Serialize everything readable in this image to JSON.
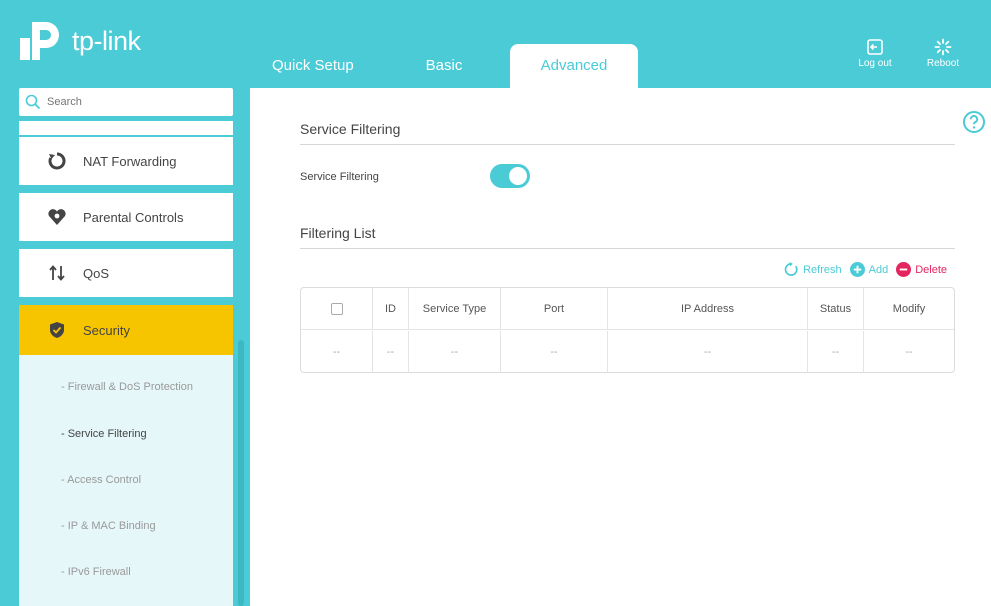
{
  "brand": {
    "name": "tp-link"
  },
  "colors": {
    "accent": "#4acbd6",
    "active_nav": "#f7c500",
    "add": "#4acbd6",
    "delete": "#e3265f"
  },
  "tabs": [
    {
      "label": "Quick Setup"
    },
    {
      "label": "Basic"
    },
    {
      "label": "Advanced"
    }
  ],
  "header_buttons": {
    "logout": "Log out",
    "reboot": "Reboot"
  },
  "search": {
    "placeholder": "Search"
  },
  "nav": {
    "items": [
      {
        "label": "NAT Forwarding",
        "icon": "nat-forwarding-icon"
      },
      {
        "label": "Parental Controls",
        "icon": "parental-controls-icon"
      },
      {
        "label": "QoS",
        "icon": "qos-icon"
      },
      {
        "label": "Security",
        "icon": "shield-icon"
      }
    ],
    "submenu": [
      {
        "label": "- Firewall & DoS Protection"
      },
      {
        "label": "- Service Filtering"
      },
      {
        "label": "- Access Control"
      },
      {
        "label": "- IP & MAC Binding"
      },
      {
        "label": "- IPv6 Firewall"
      }
    ]
  },
  "main": {
    "section_title": "Service Filtering",
    "toggle_label": "Service Filtering",
    "toggle_on": true,
    "list_title": "Filtering List",
    "actions": {
      "refresh": "Refresh",
      "add": "Add",
      "delete": "Delete"
    },
    "table": {
      "headers": [
        "",
        "ID",
        "Service Type",
        "Port",
        "IP Address",
        "Status",
        "Modify"
      ],
      "rows": [
        [
          "--",
          "--",
          "--",
          "--",
          "--",
          "--",
          "--"
        ]
      ]
    }
  }
}
